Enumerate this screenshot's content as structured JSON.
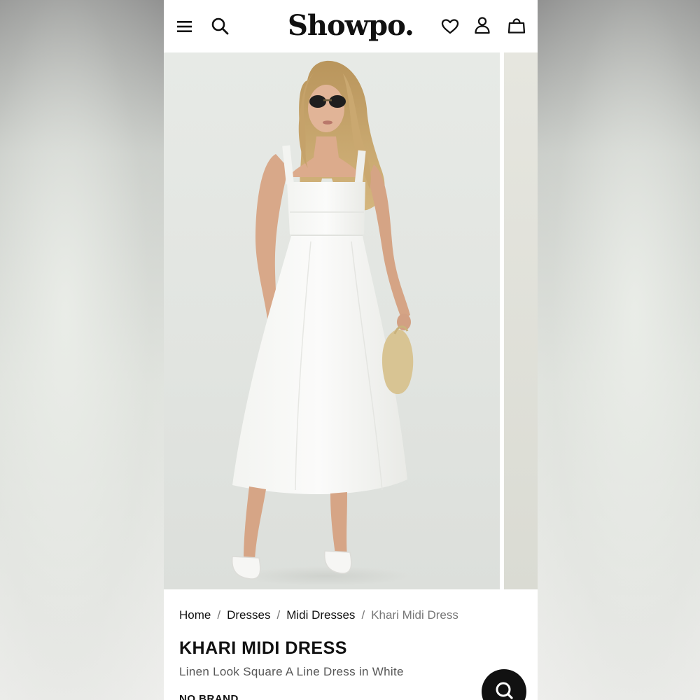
{
  "header": {
    "logo": "Showpo.",
    "icons": {
      "menu": "menu-icon",
      "search": "search-icon",
      "wishlist": "heart-icon",
      "account": "user-icon",
      "cart": "bag-icon"
    }
  },
  "breadcrumb": {
    "items": [
      "Home",
      "Dresses",
      "Midi Dresses"
    ],
    "current": "Khari Midi Dress",
    "separator": "/"
  },
  "product": {
    "title": "KHARI MIDI DRESS",
    "subtitle": "Linen Look Square A Line Dress in White",
    "brand": "NO BRAND"
  },
  "chat": {
    "icon": "chat-search-icon"
  },
  "colors": {
    "text": "#111111",
    "muted": "#777777",
    "background": "#ffffff"
  }
}
